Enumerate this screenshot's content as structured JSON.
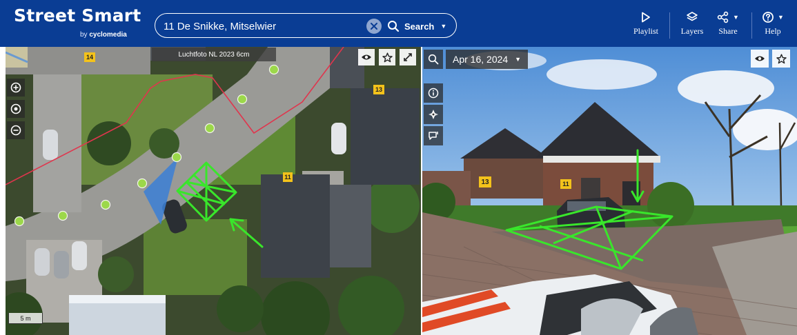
{
  "app": {
    "title": "Street Smart",
    "subtitle_prefix": "by",
    "subtitle_brand": "cyclomedia"
  },
  "search": {
    "value": "11 De Snikke, Mitselwier",
    "button_label": "Search"
  },
  "toolbar": {
    "playlist_label": "Playlist",
    "layers_label": "Layers",
    "share_label": "Share",
    "help_label": "Help"
  },
  "map_panel": {
    "photo_label": "Luchtfoto NL 2023 6cm",
    "scale_label": "5 m",
    "house_numbers": [
      "14",
      "13",
      "11"
    ]
  },
  "street_panel": {
    "date": "Apr 16, 2024",
    "house_numbers": [
      "13",
      "11"
    ]
  },
  "colors": {
    "header": "#0a3d94",
    "overlay_green": "#39e62b",
    "parcel_line": "#e0354d",
    "number_badge": "#f3c21b"
  }
}
